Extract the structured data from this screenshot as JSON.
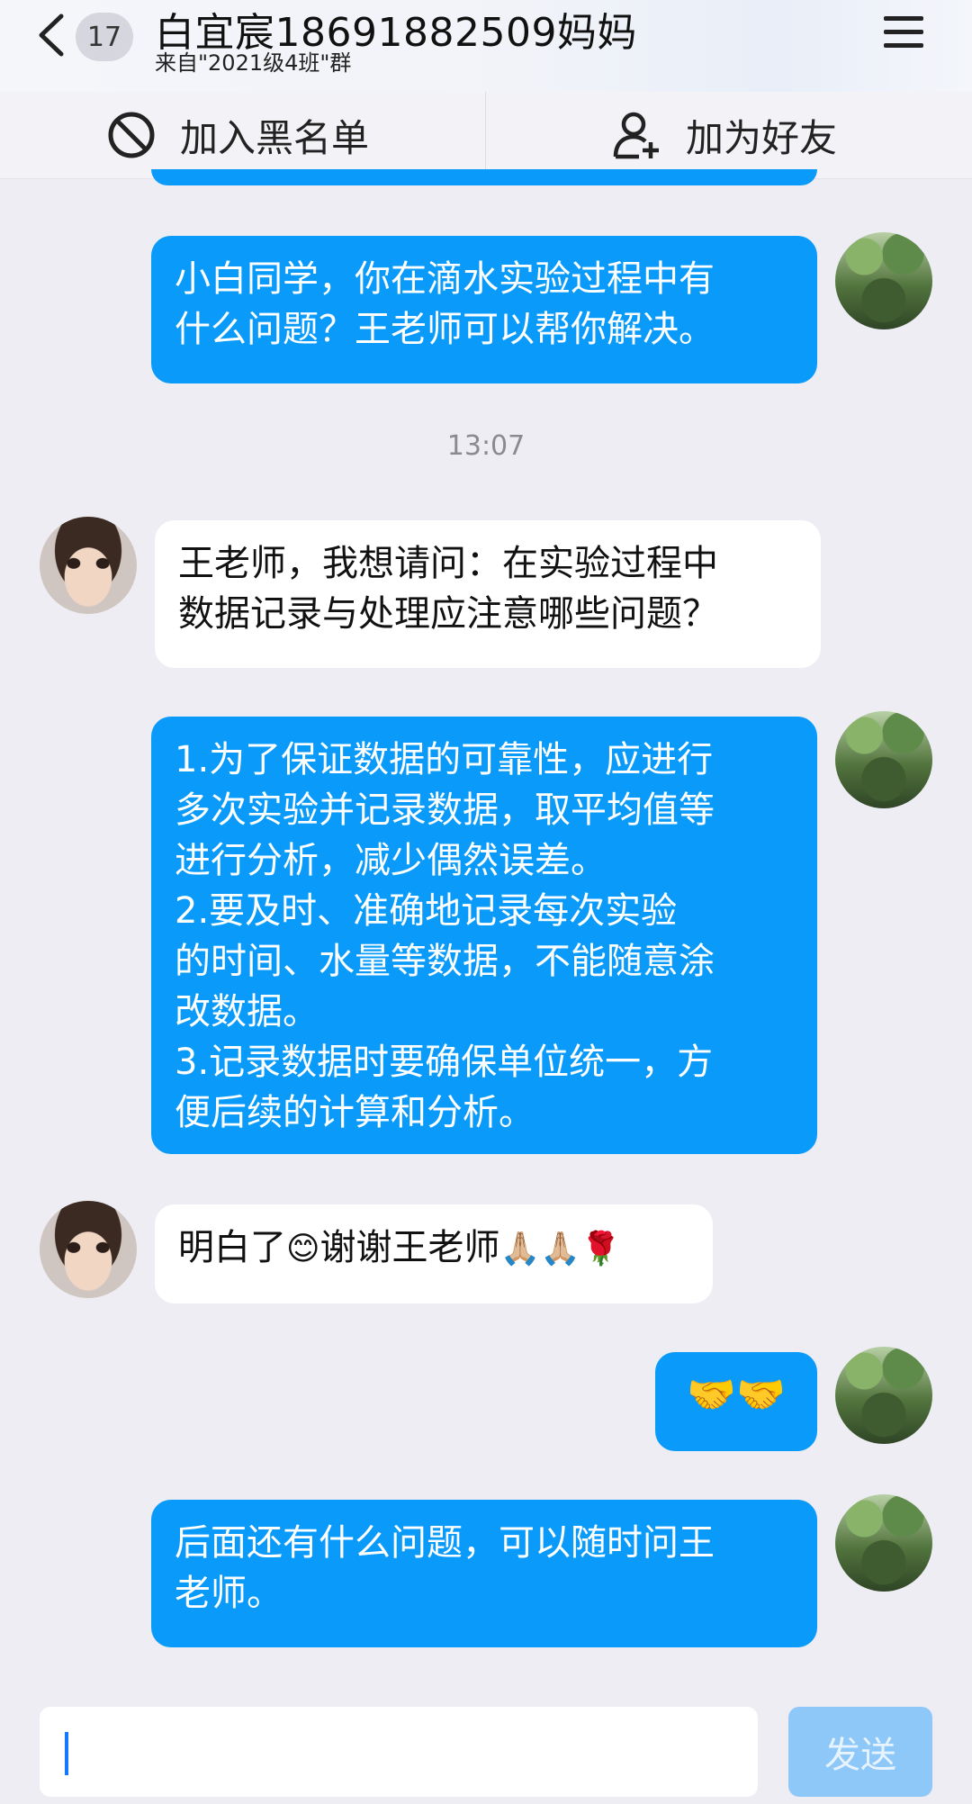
{
  "header": {
    "unread_count": "17",
    "title": "白宜宸18691882509妈妈",
    "subtitle": "来自\"2021级4班\"群"
  },
  "actions": {
    "blacklist_label": "加入黑名单",
    "add_friend_label": "加为好友"
  },
  "messages": {
    "m1": "小白同学，你在滴水实验过程中有\n什么问题？王老师可以帮你解决。",
    "time": "13:07",
    "m2": "王老师，我想请问：在实验过程中\n数据记录与处理应注意哪些问题？",
    "m3": "1.为了保证数据的可靠性，应进行\n多次实验并记录数据，取平均值等\n进行分析，减少偶然误差。\n 2.要及时、准确地记录每次实验\n的时间、水量等数据，不能随意涂\n改数据。\n3.记录数据时要确保单位统一，方\n便后续的计算和分析。",
    "m4_text1": "明白了",
    "m4_emoji1": "😊",
    "m4_text2": "谢谢王老师",
    "m4_emoji2": "🙏🏼🙏🏼🌹",
    "m5": "🤝🤝",
    "m6": "后面还有什么问题，可以随时问王\n老师。"
  },
  "input": {
    "placeholder": "",
    "send_label": "发送"
  },
  "icons": {
    "back": "chevron-left-icon",
    "menu": "hamburger-menu-icon",
    "blacklist": "block-icon",
    "add_friend": "add-user-icon"
  },
  "colors": {
    "out_bubble": "#0a9bfa",
    "in_bubble": "#ffffff",
    "send_button": "#8ec8f8",
    "background": "#ededf3"
  }
}
